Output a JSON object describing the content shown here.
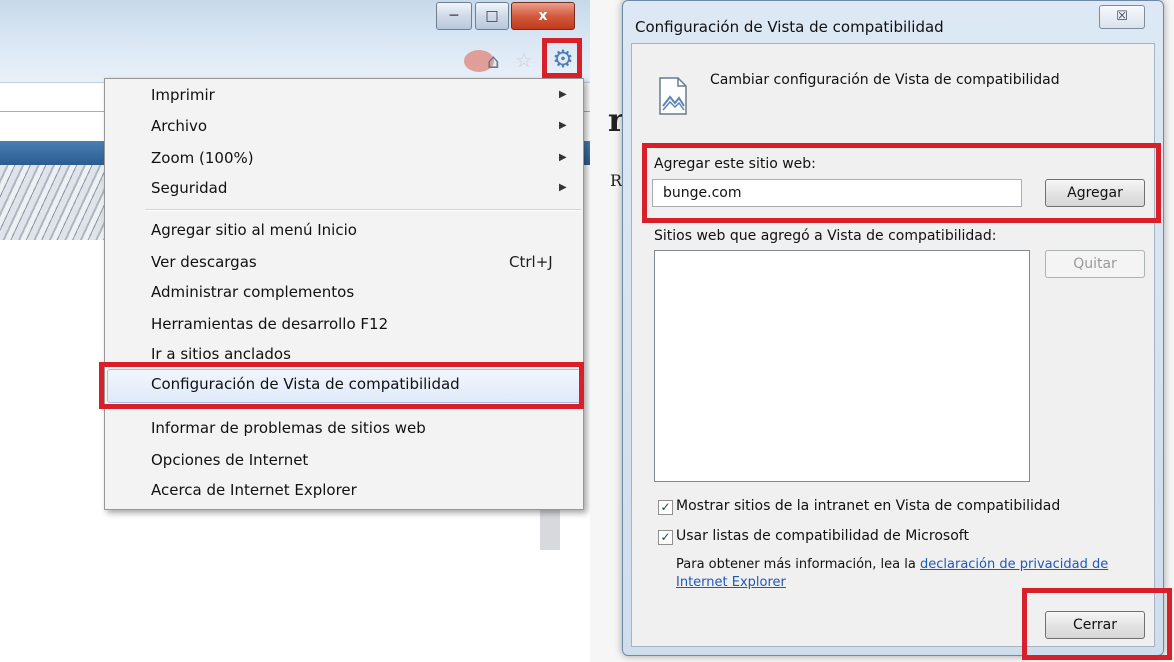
{
  "left_window": {
    "caption_buttons": {
      "minimize": "─",
      "maximize": "□",
      "close": "x"
    },
    "toolbar_icons": [
      "home-icon",
      "star-icon",
      "gear-icon"
    ],
    "menu": {
      "items": [
        {
          "label": "Imprimir",
          "submenu": true
        },
        {
          "label": "Archivo",
          "submenu": true
        },
        {
          "label": "Zoom (100%)",
          "submenu": true
        },
        {
          "label": "Seguridad",
          "submenu": true
        },
        {
          "label": "Agregar sitio al menú Inicio"
        },
        {
          "label": "Ver descargas",
          "shortcut": "Ctrl+J"
        },
        {
          "label": "Administrar complementos"
        },
        {
          "label": "Herramientas de desarrollo F12"
        },
        {
          "label": "Ir a sitios anclados"
        },
        {
          "label": "Configuración de Vista de compatibilidad"
        },
        {
          "label": "Informar de problemas de sitios web"
        },
        {
          "label": "Opciones de Internet"
        },
        {
          "label": "Acerca de Internet Explorer"
        }
      ]
    }
  },
  "background_text": {
    "big": "r",
    "small": "R"
  },
  "dialog": {
    "title": "Configuración de Vista de compatibilidad",
    "close_glyph": "☒",
    "heading": "Cambiar configuración de Vista de compatibilidad",
    "add_label": "Agregar este sitio web:",
    "site_value": "bunge.com",
    "add_button": "Agregar",
    "list_label": "Sitios web que agregó a Vista de compatibilidad:",
    "remove_button": "Quitar",
    "checkbox1": {
      "label": "Mostrar sitios de la intranet en Vista de compatibilidad",
      "checked": true
    },
    "checkbox2": {
      "label": "Usar listas de compatibilidad de Microsoft",
      "checked": true
    },
    "checkmark": "✓",
    "info_text": "Para obtener más información, lea la",
    "info_link": "declaración de privacidad de",
    "info_link2": "Internet Explorer",
    "close_button": "Cerrar"
  },
  "colors": {
    "highlight": "#d8202a",
    "link": "#1f59b6",
    "gear": "#4d7fb6"
  }
}
